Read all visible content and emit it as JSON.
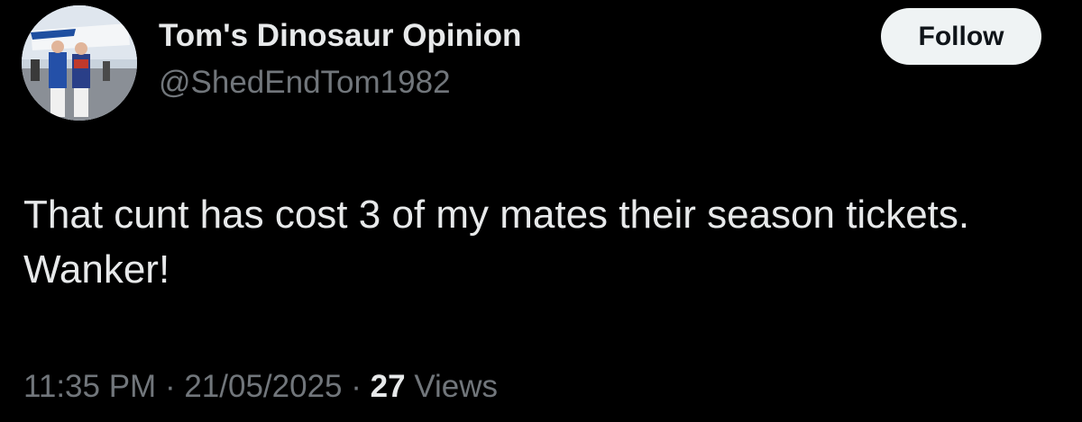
{
  "tweet": {
    "author": {
      "display_name": "Tom's Dinosaur Opinion",
      "handle": "@ShedEndTom1982",
      "avatar_icon": "profile-photo"
    },
    "follow_label": "Follow",
    "text": "That cunt has cost 3 of my mates their season tickets. Wanker!",
    "meta": {
      "time": "11:35 PM",
      "separator": "·",
      "date": "21/05/2025",
      "views_count": "27",
      "views_label": "Views"
    }
  },
  "colors": {
    "background": "#000000",
    "primary_text": "#e7e9ea",
    "secondary_text": "#71767b",
    "follow_bg": "#eff3f4",
    "follow_text": "#0f1419"
  }
}
